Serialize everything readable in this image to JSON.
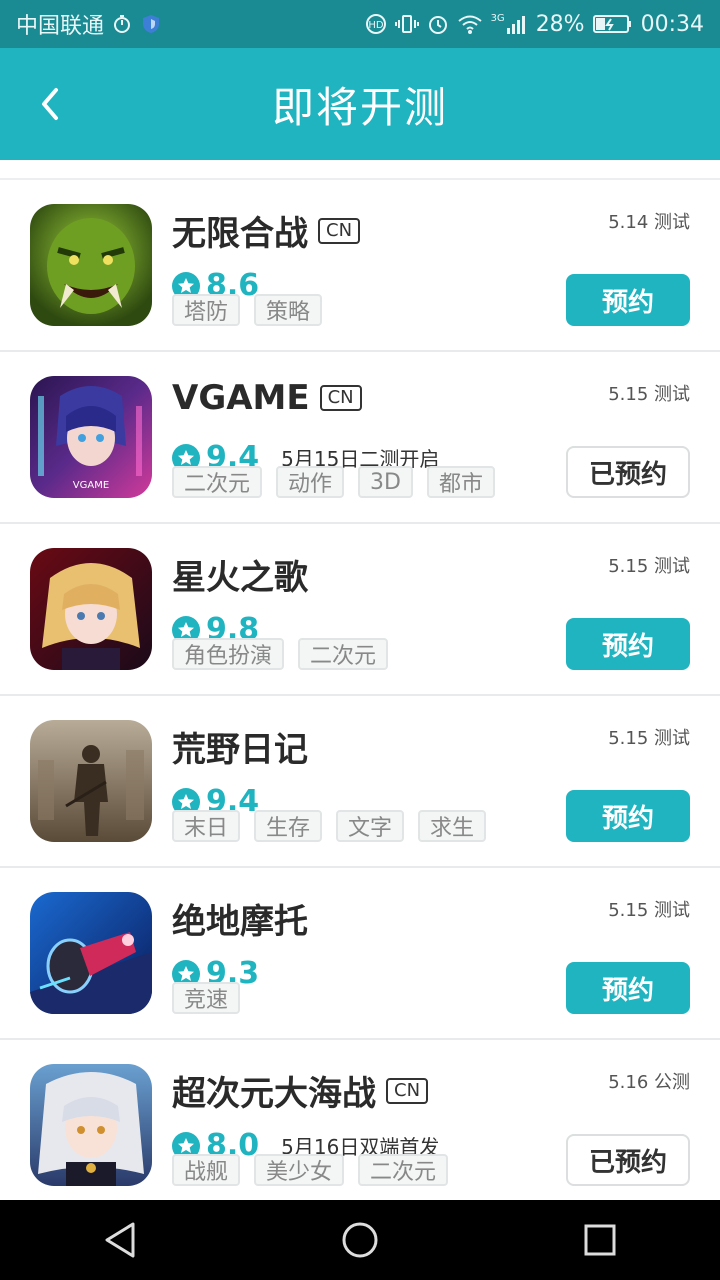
{
  "status_bar": {
    "carrier": "中国联通",
    "network": "3G",
    "battery": "28%",
    "time": "00:34"
  },
  "header": {
    "title": "即将开测"
  },
  "games": [
    {
      "name": "无限合战",
      "cn": "CN",
      "date": "5.14 测试",
      "rating": "8.6",
      "note": "",
      "tags": [
        "塔防",
        "策略"
      ],
      "button": "预约",
      "reserved": false
    },
    {
      "name": "VGAME",
      "cn": "CN",
      "date": "5.15 测试",
      "rating": "9.4",
      "note": "5月15日二测开启",
      "tags": [
        "二次元",
        "动作",
        "3D",
        "都市"
      ],
      "button": "已预约",
      "reserved": true
    },
    {
      "name": "星火之歌",
      "cn": "",
      "date": "5.15 测试",
      "rating": "9.8",
      "note": "",
      "tags": [
        "角色扮演",
        "二次元"
      ],
      "button": "预约",
      "reserved": false
    },
    {
      "name": "荒野日记",
      "cn": "",
      "date": "5.15 测试",
      "rating": "9.4",
      "note": "",
      "tags": [
        "末日",
        "生存",
        "文字",
        "求生"
      ],
      "button": "预约",
      "reserved": false
    },
    {
      "name": "绝地摩托",
      "cn": "",
      "date": "5.15 测试",
      "rating": "9.3",
      "note": "",
      "tags": [
        "竞速"
      ],
      "button": "预约",
      "reserved": false
    },
    {
      "name": "超次元大海战",
      "cn": "CN",
      "date": "5.16 公测",
      "rating": "8.0",
      "note": "5月16日双端首发",
      "tags": [
        "战舰",
        "美少女",
        "二次元"
      ],
      "button": "已预约",
      "reserved": true
    }
  ]
}
